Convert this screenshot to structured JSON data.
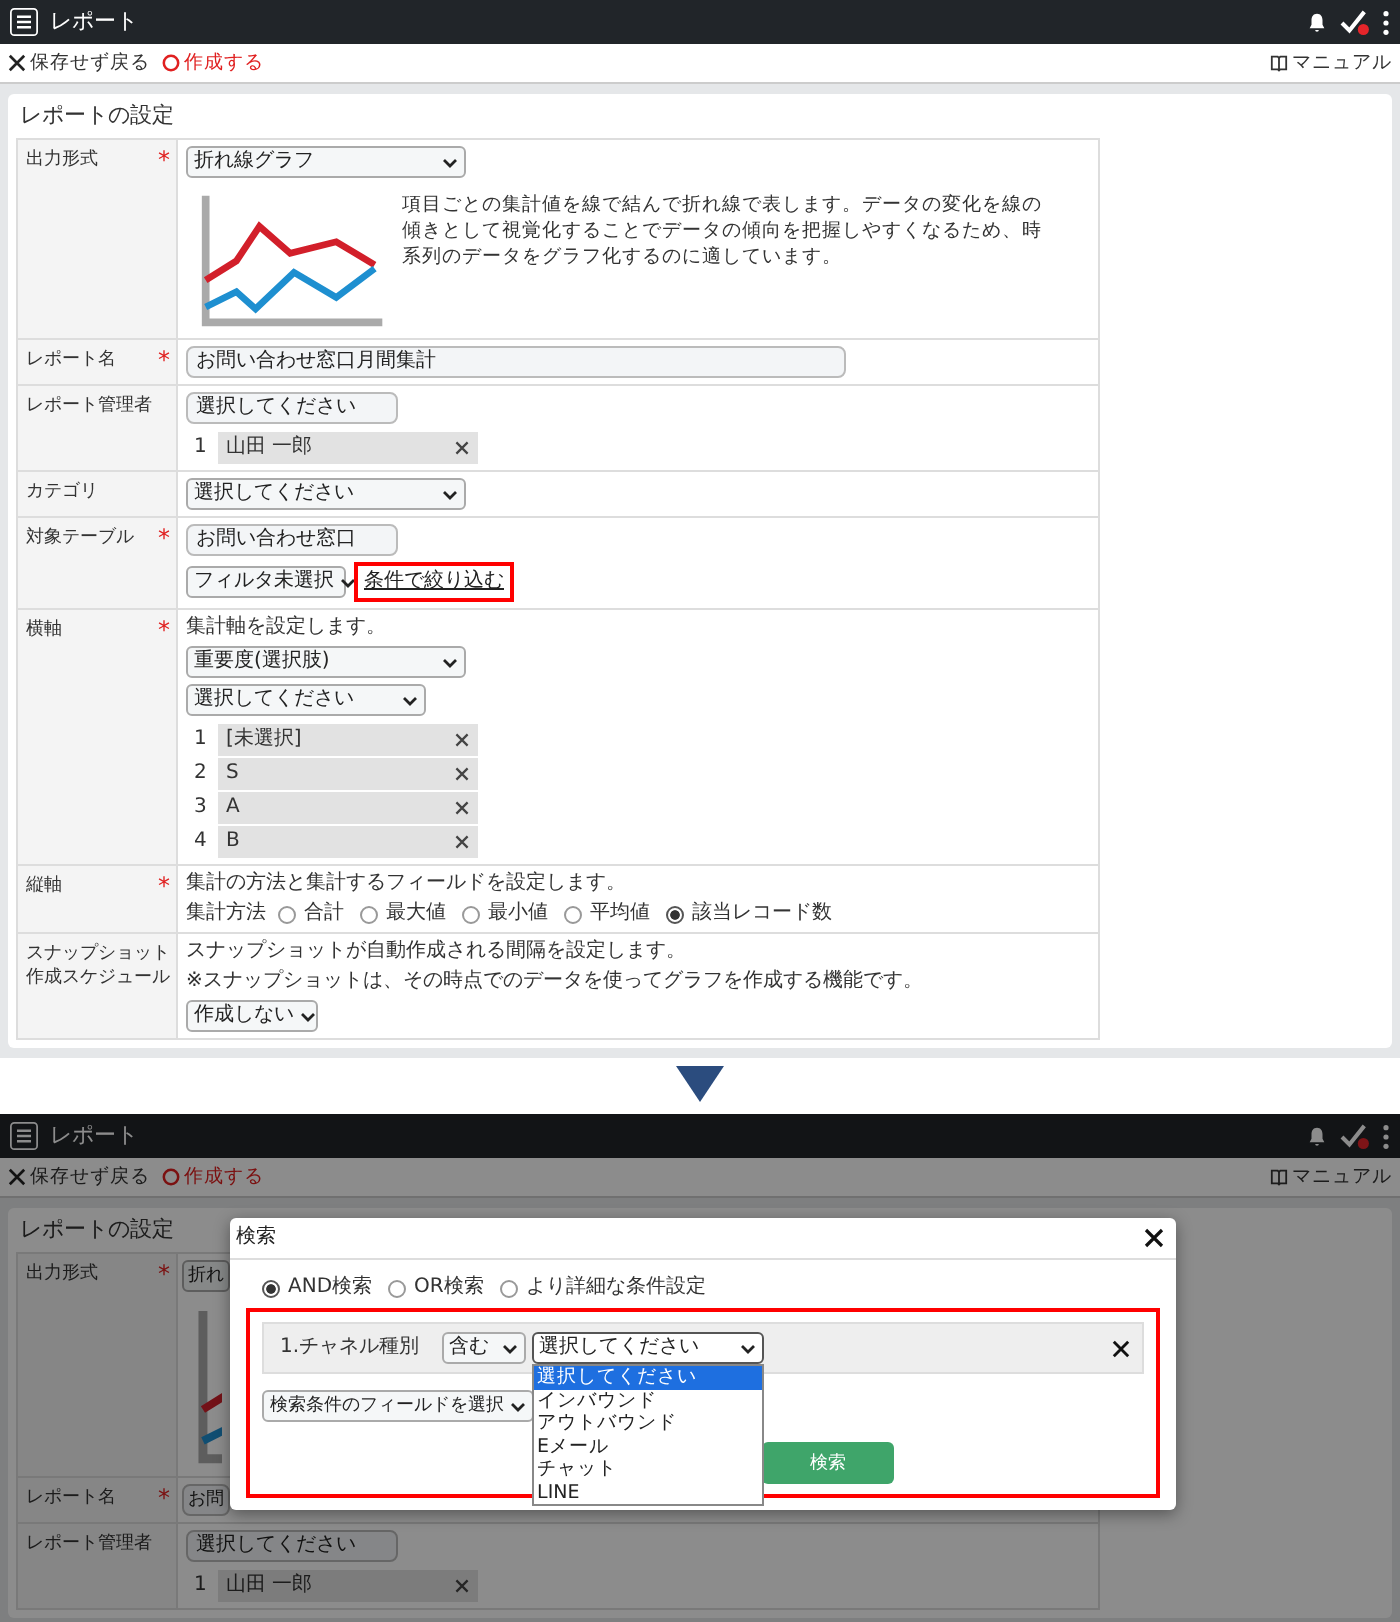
{
  "screens": [
    {
      "header": {
        "title": "レポート"
      },
      "toolbar": {
        "back": "保存せず戻る",
        "create": "作成する",
        "manual": "マニュアル"
      },
      "section_title": "レポートの設定",
      "rows": [
        {
          "kind": "chart_type",
          "label": "出力形式",
          "required_mark": "*",
          "select": "折れ線グラフ",
          "description": "項目ごとの集計値を線で結んで折れ線で表します。データの変化を線の傾きとして視覚化することでデータの傾向を把握しやすくなるため、時系列のデータをグラフ化するのに適しています。"
        },
        {
          "kind": "text",
          "label": "レポート名",
          "required_mark": "*",
          "value": "お問い合わせ窓口月間集計"
        },
        {
          "kind": "picker",
          "label": "レポート管理者",
          "field": "選択してください",
          "items": [
            {
              "index": "1",
              "text": "山田 一郎"
            }
          ]
        },
        {
          "kind": "select",
          "label": "カテゴリ",
          "select": "選択してください"
        },
        {
          "kind": "table",
          "label": "対象テーブル",
          "required_mark": "*",
          "field": "お問い合わせ窓口",
          "filter_select": "フィルタ未選択",
          "link": {
            "text": "条件で絞り込む",
            "highlighted": true
          }
        },
        {
          "kind": "axis",
          "label": "横軸",
          "required_mark": "*",
          "note": "集計軸を設定します。",
          "selects": [
            "重要度(選択肢)",
            "選択してください"
          ],
          "items": [
            {
              "index": "1",
              "text": "[未選択]"
            },
            {
              "index": "2",
              "text": "S"
            },
            {
              "index": "3",
              "text": "A"
            },
            {
              "index": "4",
              "text": "B"
            }
          ]
        },
        {
          "kind": "radio",
          "label": "縦軸",
          "required_mark": "*",
          "note": "集計の方法と集計するフィールドを設定します。",
          "group_label": "集計方法",
          "options": [
            {
              "label": "合計",
              "selected": false
            },
            {
              "label": "最大値",
              "selected": false
            },
            {
              "label": "最小値",
              "selected": false
            },
            {
              "label": "平均値",
              "selected": false
            },
            {
              "label": "該当レコード数",
              "selected": true
            }
          ]
        },
        {
          "kind": "snapshot",
          "label": "スナップショット作成スケジュール",
          "notes": [
            "スナップショットが自動作成される間隔を設定します。",
            "※スナップショットは、その時点でのデータを使ってグラフを作成する機能です。"
          ],
          "select": "作成しない"
        }
      ]
    },
    {
      "header": {
        "title": "レポート"
      },
      "toolbar": {
        "back": "保存せず戻る",
        "create": "作成する",
        "manual": "マニュアル"
      },
      "section_title": "レポートの設定",
      "rows": [
        {
          "kind": "chart_type",
          "label": "出力形式",
          "required_mark": "*",
          "select": "折れ"
        },
        {
          "kind": "text",
          "label": "レポート名",
          "required_mark": "*",
          "value": "お問"
        },
        {
          "kind": "picker",
          "label": "レポート管理者",
          "field": "選択してください",
          "items": [
            {
              "index": "1",
              "text": "山田 一郎"
            }
          ]
        }
      ],
      "dialog": {
        "title": "検索",
        "modes": [
          {
            "label": "AND検索",
            "selected": true
          },
          {
            "label": "OR検索",
            "selected": false
          },
          {
            "label": "より詳細な条件設定",
            "selected": false
          }
        ],
        "condition_area": {
          "highlighted": true,
          "condition_label": "1.チャネル種別",
          "operator": "含む",
          "value": "選択してください",
          "options": [
            {
              "label": "選択してください",
              "selected": true
            },
            {
              "label": "インバウンド",
              "selected": false
            },
            {
              "label": "アウトバウンド",
              "selected": false
            },
            {
              "label": "Eメール",
              "selected": false
            },
            {
              "label": "チャット",
              "selected": false
            },
            {
              "label": "LINE",
              "selected": false
            }
          ],
          "field_select": "検索条件のフィールドを選択",
          "search_button": "検索"
        }
      }
    }
  ]
}
